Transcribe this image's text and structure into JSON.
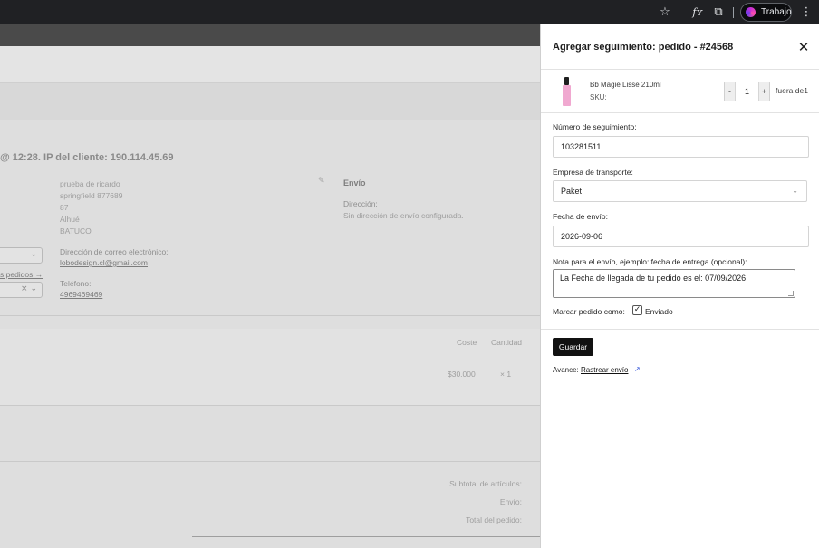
{
  "browser": {
    "profile_label": "Trabajo",
    "icons": [
      "star-icon",
      "font-icon",
      "extensions-icon",
      "menu-icon"
    ]
  },
  "background": {
    "heading": "@ 12:28. IP del cliente: 190.114.45.69",
    "billing_address": [
      "prueba de ricardo",
      "springfield 877689",
      "87",
      "Alhué",
      "BATUCO"
    ],
    "email_label": "Dirección de correo electrónico:",
    "email_value": "lobodesign.cl@gmail.com",
    "phone_label": "Teléfono:",
    "phone_value": "4969469469",
    "orders_link": "s pedidos →",
    "shipping_title": "Envío",
    "shipping_address_label": "Dirección:",
    "shipping_address_value": "Sin dirección de envío configurada.",
    "items_header": {
      "cost": "Coste",
      "quantity": "Cantidad"
    },
    "item_row": {
      "cost": "$30.000",
      "quantity": "× 1"
    },
    "totals": [
      "Subtotal de artículos:",
      "Envío:",
      "Total del pedido:"
    ]
  },
  "panel": {
    "title": "Agregar seguimiento: pedido - #24568",
    "product": {
      "name": "Bb Magie Lisse 210ml",
      "sku_label": "SKU:",
      "quantity": "1",
      "minus": "-",
      "plus": "+",
      "of_label": "fuera de1"
    },
    "tracking_label": "Número de seguimiento:",
    "tracking_value": "103281511",
    "carrier_label": "Empresa de transporte:",
    "carrier_value": "Paket",
    "date_label": "Fecha de envío:",
    "date_value": "2026-09-06",
    "note_label": "Nota para el envío, ejemplo: fecha de entrega (opcional):",
    "note_value": "La Fecha de llegada de tu pedido es el: 07/09/2026",
    "mark_label": "Marcar pedido como:",
    "mark_option": "Enviado",
    "mark_checked": true,
    "save_label": "Guardar",
    "progress_label": "Avance:",
    "progress_link": "Rastrear envío"
  }
}
